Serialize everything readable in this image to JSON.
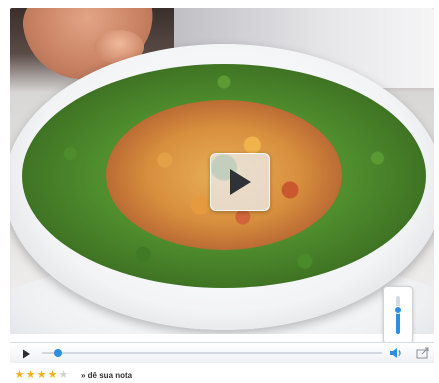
{
  "player": {
    "progress_fraction": 0.0,
    "volume_fraction": 0.62,
    "accent_color": "#2d8fe0",
    "icons": {
      "overlay_play": "play-icon",
      "play": "play-icon",
      "volume": "speaker-icon",
      "share": "share-icon"
    }
  },
  "rating": {
    "stars_filled": 4,
    "stars_total": 5,
    "star_color": "#f2b01e",
    "label": "» dê sua nota"
  }
}
